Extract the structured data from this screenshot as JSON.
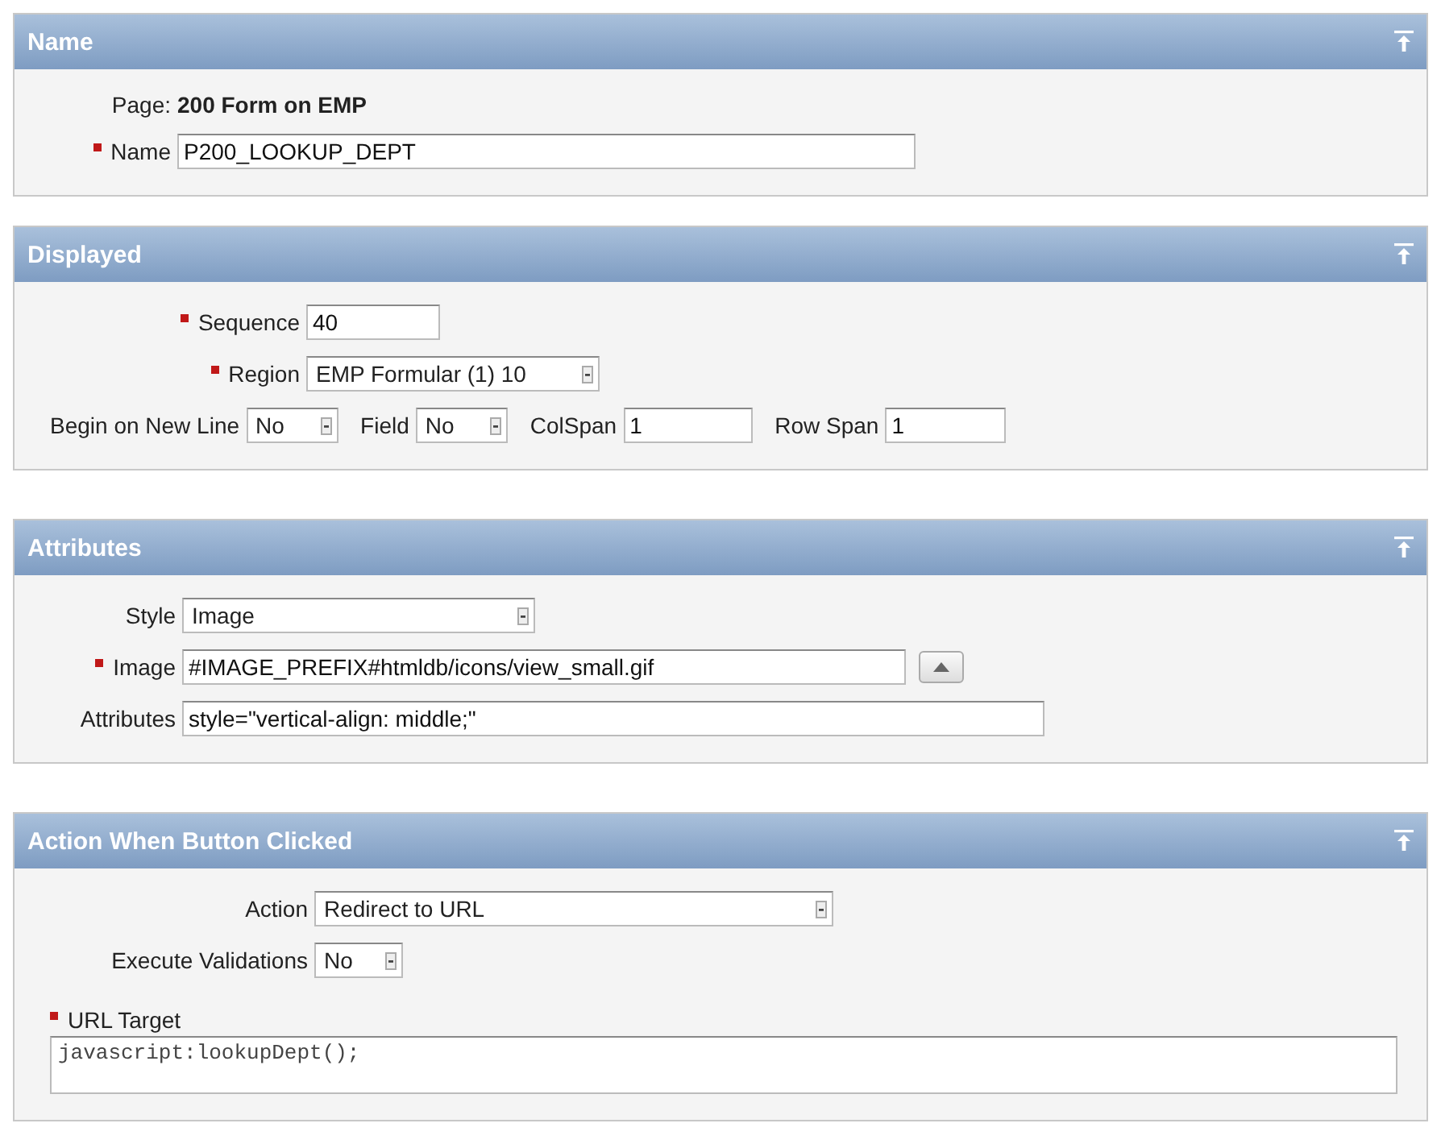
{
  "sections": [
    {
      "title": "Name",
      "rows": [
        {
          "items": [
            {
              "kind": "static",
              "label": "Page:",
              "value": "200 Form on EMP",
              "required": false
            }
          ]
        },
        {
          "items": [
            {
              "kind": "text",
              "label": "Name",
              "value": "P200_LOOKUP_DEPT",
              "required": true
            }
          ]
        }
      ]
    },
    {
      "title": "Displayed",
      "rows": [
        {
          "items": [
            {
              "kind": "text",
              "label": "Sequence",
              "value": "40",
              "required": true
            }
          ]
        },
        {
          "items": [
            {
              "kind": "select",
              "label": "Region",
              "value": "EMP Formular (1) 10",
              "required": true
            }
          ]
        },
        {
          "items": [
            {
              "kind": "select",
              "label": "Begin on New Line",
              "value": "No",
              "required": false
            },
            {
              "kind": "select",
              "label": "Field",
              "value": "No",
              "required": false
            },
            {
              "kind": "text",
              "label": "ColSpan",
              "value": "1",
              "required": false
            },
            {
              "kind": "text",
              "label": "Row Span",
              "value": "1",
              "required": false
            }
          ]
        }
      ]
    },
    {
      "title": "Attributes",
      "rows": [
        {
          "items": [
            {
              "kind": "select",
              "label": "Style",
              "value": "Image",
              "required": false
            }
          ]
        },
        {
          "items": [
            {
              "kind": "picker",
              "label": "Image",
              "value": "#IMAGE_PREFIX#htmldb/icons/view_small.gif",
              "required": true
            }
          ]
        },
        {
          "items": [
            {
              "kind": "text",
              "label": "Attributes",
              "value": "style=\"vertical-align: middle;\"",
              "required": false
            }
          ]
        }
      ]
    },
    {
      "title": "Action When Button Clicked",
      "rows": [
        {
          "items": [
            {
              "kind": "select",
              "label": "Action",
              "value": "Redirect to URL",
              "required": false
            }
          ]
        },
        {
          "items": [
            {
              "kind": "select",
              "label": "Execute Validations",
              "value": "No",
              "required": false
            }
          ]
        },
        {
          "items": [
            {
              "kind": "textarea",
              "label": "URL Target",
              "value": "javascript:lookupDept();",
              "required": true
            }
          ]
        }
      ]
    }
  ]
}
